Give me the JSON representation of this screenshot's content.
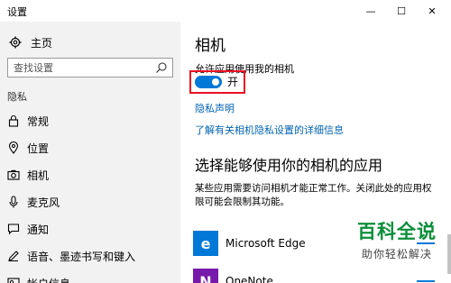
{
  "window": {
    "title": "设置",
    "min": "—",
    "max": "☐",
    "close": "✕"
  },
  "sidebar": {
    "home": "主页",
    "search_placeholder": "查找设置",
    "section": "隐私",
    "items": [
      {
        "label": "常规",
        "icon": "lock-icon"
      },
      {
        "label": "位置",
        "icon": "location-pin-icon"
      },
      {
        "label": "相机",
        "icon": "camera-icon",
        "active": true
      },
      {
        "label": "麦克风",
        "icon": "microphone-icon"
      },
      {
        "label": "通知",
        "icon": "speech-bubble-icon"
      },
      {
        "label": "语音、墨迹书写和键入",
        "icon": "pen-icon"
      },
      {
        "label": "帐户信息",
        "icon": "account-icon"
      }
    ]
  },
  "main": {
    "title": "相机",
    "allow_label": "允许应用使用我的相机",
    "toggle_state": "开",
    "privacy_link": "隐私声明",
    "details_link": "了解有关相机隐私设置的详细信息",
    "apps_title": "选择能够使用你的相机的应用",
    "apps_desc": "某些应用需要访问相机才能正常工作。关闭此处的应用权限可能会限制其功能。",
    "apps": [
      {
        "name": "Microsoft Edge",
        "icon": "edge-icon",
        "color": "#0078d7"
      },
      {
        "name": "OneNote",
        "icon": "onenote-icon",
        "color": "#7719aa"
      }
    ]
  },
  "watermark": {
    "line1": "百科全说",
    "line2": "助你轻松解决"
  },
  "colors": {
    "accent": "#0078d7",
    "highlight": "#e81123",
    "link": "#0063b1"
  }
}
